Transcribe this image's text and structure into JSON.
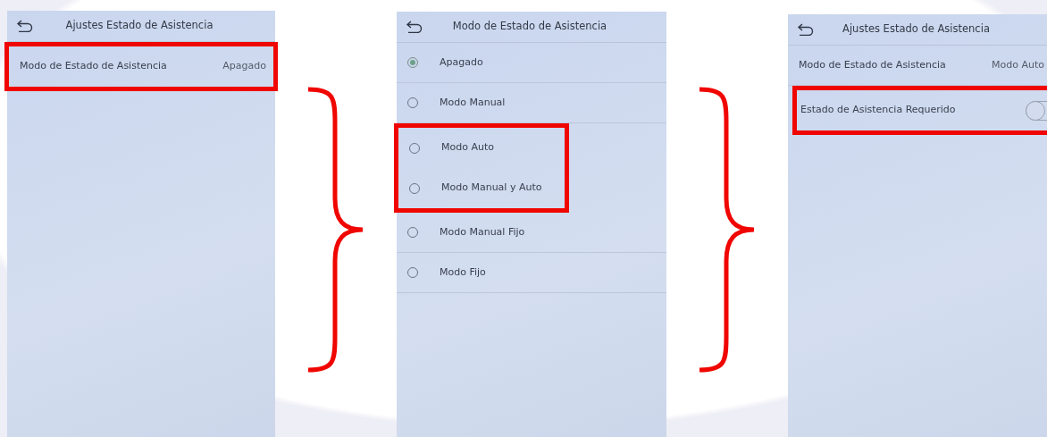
{
  "screens": [
    {
      "title": "Ajustes Estado de Asistencia",
      "rows": [
        {
          "kind": "value",
          "label": "Modo de Estado de Asistencia",
          "value": "Apagado",
          "highlighted": true
        }
      ]
    },
    {
      "title": "Modo de Estado de Asistencia",
      "rows": [
        {
          "kind": "radio",
          "label": "Apagado",
          "selected": true,
          "highlighted": false
        },
        {
          "kind": "radio",
          "label": "Modo Manual",
          "selected": false,
          "highlighted": false
        },
        {
          "kind": "radio",
          "label": "Modo Auto",
          "selected": false,
          "highlighted": true
        },
        {
          "kind": "radio",
          "label": "Modo Manual y Auto",
          "selected": false,
          "highlighted": true
        },
        {
          "kind": "radio",
          "label": "Modo Manual Fijo",
          "selected": false,
          "highlighted": false
        },
        {
          "kind": "radio",
          "label": "Modo Fijo",
          "selected": false,
          "highlighted": false
        }
      ]
    },
    {
      "title": "Ajustes Estado de Asistencia",
      "rows": [
        {
          "kind": "value",
          "label": "Modo de Estado de Asistencia",
          "value": "Modo Auto",
          "highlighted": false
        },
        {
          "kind": "toggle",
          "label": "Estado de Asistencia Requerido",
          "on": false,
          "highlighted": true
        }
      ]
    }
  ]
}
